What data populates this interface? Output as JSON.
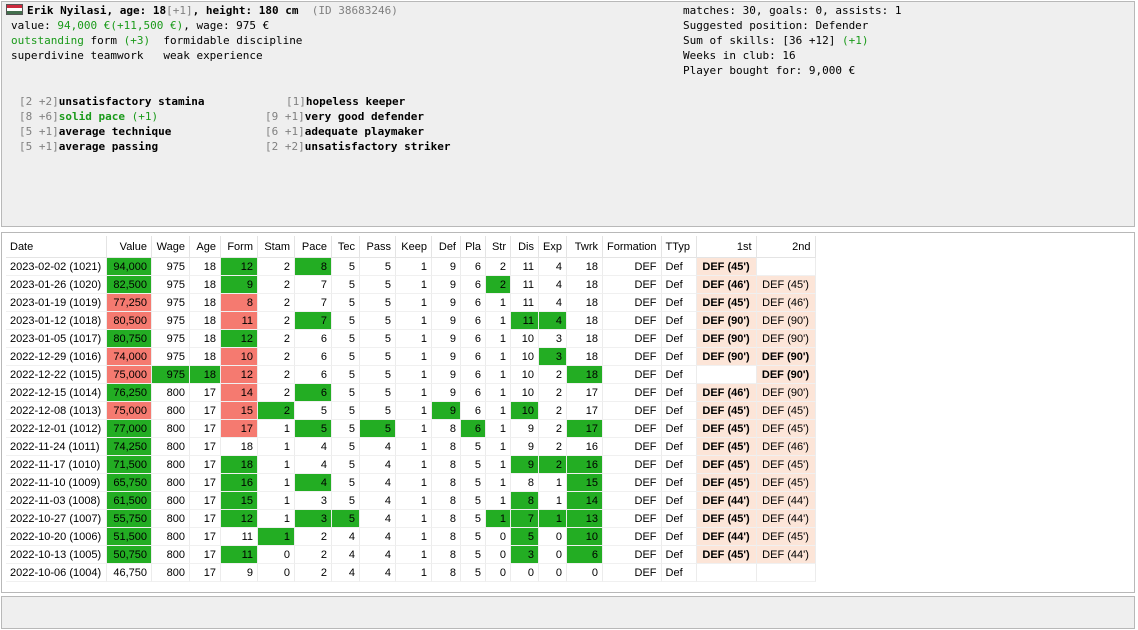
{
  "player": {
    "line1": {
      "name_age": "Erik Nyilasi, age: 18",
      "age_delta": "[+1]",
      "height": ", height: 180 cm",
      "id": "(ID 38683246)"
    },
    "line2": {
      "value_label": "value: ",
      "value": "94,000 €(+11,500 €)",
      "wage": ", wage: 975 €"
    },
    "line3": {
      "form": "outstanding",
      "form_word": " form ",
      "form_delta": "(+3)",
      "discipline": "formidable discipline"
    },
    "line4": {
      "teamwork": "superdivine teamwork",
      "experience": "weak experience"
    },
    "flag_colors": [
      "#cd2a3e",
      "#ffffff",
      "#436f4d"
    ]
  },
  "summary": {
    "matches": "matches: 30, goals: 0, assists: 1",
    "position": "Suggested position: Defender",
    "skills": "Sum of skills: [36 +12]",
    "skills_delta": "(+1)",
    "weeks": "Weeks in club: 16",
    "bought": "Player bought for: 9,000 €"
  },
  "skills_left": [
    {
      "bracket": "[2 +2]",
      "text": "unsatisfactory stamina",
      "delta": "",
      "green": false
    },
    {
      "bracket": "[8 +6]",
      "text": "solid pace",
      "delta": " (+1)",
      "green": true
    },
    {
      "bracket": "[5 +1]",
      "text": "average technique",
      "delta": "",
      "green": false
    },
    {
      "bracket": "[5 +1]",
      "text": "average passing",
      "delta": "",
      "green": false
    }
  ],
  "skills_right": [
    {
      "bracket": "[1]",
      "text": "hopeless keeper"
    },
    {
      "bracket": "[9 +1]",
      "text": "very good defender"
    },
    {
      "bracket": "[6 +1]",
      "text": "adequate playmaker"
    },
    {
      "bracket": "[2 +2]",
      "text": "unsatisfactory striker"
    }
  ],
  "table": {
    "headers": [
      "Date",
      "Value",
      "Wage",
      "Age",
      "Form",
      "Stam",
      "Pace",
      "Tec",
      "Pass",
      "Keep",
      "Def",
      "Pla",
      "Str",
      "Dis",
      "Exp",
      "Twrk",
      "Formation",
      "TTyp",
      "1st",
      "2nd"
    ],
    "rows": [
      {
        "cells": [
          "2023-02-02 (1021)",
          "94,000",
          "975",
          "18",
          "12",
          "2",
          "8",
          "5",
          "5",
          "1",
          "9",
          "6",
          "2",
          "11",
          "4",
          "18",
          "DEF",
          "Def",
          "DEF (45')",
          ""
        ],
        "hl": {
          "1": "g",
          "4": "g",
          "6": "g"
        },
        "p": [
          "p1",
          "e"
        ]
      },
      {
        "cells": [
          "2023-01-26 (1020)",
          "82,500",
          "975",
          "18",
          "9",
          "2",
          "7",
          "5",
          "5",
          "1",
          "9",
          "6",
          "2",
          "11",
          "4",
          "18",
          "DEF",
          "Def",
          "DEF (46')",
          "DEF (45')"
        ],
        "hl": {
          "1": "g",
          "4": "g",
          "12": "g"
        },
        "p": [
          "p1",
          "p2"
        ]
      },
      {
        "cells": [
          "2023-01-19 (1019)",
          "77,250",
          "975",
          "18",
          "8",
          "2",
          "7",
          "5",
          "5",
          "1",
          "9",
          "6",
          "1",
          "11",
          "4",
          "18",
          "DEF",
          "Def",
          "DEF (45')",
          "DEF (46')"
        ],
        "hl": {
          "1": "r",
          "4": "r"
        },
        "p": [
          "p1",
          "p2"
        ]
      },
      {
        "cells": [
          "2023-01-12 (1018)",
          "80,500",
          "975",
          "18",
          "11",
          "2",
          "7",
          "5",
          "5",
          "1",
          "9",
          "6",
          "1",
          "11",
          "4",
          "18",
          "DEF",
          "Def",
          "DEF (90')",
          "DEF (90')"
        ],
        "hl": {
          "1": "r",
          "4": "r",
          "6": "g",
          "13": "g",
          "14": "g"
        },
        "p": [
          "p1",
          "p2"
        ]
      },
      {
        "cells": [
          "2023-01-05 (1017)",
          "80,750",
          "975",
          "18",
          "12",
          "2",
          "6",
          "5",
          "5",
          "1",
          "9",
          "6",
          "1",
          "10",
          "3",
          "18",
          "DEF",
          "Def",
          "DEF (90')",
          "DEF (90')"
        ],
        "hl": {
          "1": "g",
          "4": "g"
        },
        "p": [
          "p1",
          "p2"
        ]
      },
      {
        "cells": [
          "2022-12-29 (1016)",
          "74,000",
          "975",
          "18",
          "10",
          "2",
          "6",
          "5",
          "5",
          "1",
          "9",
          "6",
          "1",
          "10",
          "3",
          "18",
          "DEF",
          "Def",
          "DEF (90')",
          "DEF (90')"
        ],
        "hl": {
          "1": "r",
          "4": "r",
          "14": "g"
        },
        "p": [
          "p1",
          "p2b"
        ]
      },
      {
        "cells": [
          "2022-12-22 (1015)",
          "75,000",
          "975",
          "18",
          "12",
          "2",
          "6",
          "5",
          "5",
          "1",
          "9",
          "6",
          "1",
          "10",
          "2",
          "18",
          "DEF",
          "Def",
          "",
          "DEF (90')"
        ],
        "hl": {
          "1": "r",
          "2": "g",
          "3": "g",
          "4": "r",
          "15": "g"
        },
        "p": [
          "e",
          "p2b"
        ]
      },
      {
        "cells": [
          "2022-12-15 (1014)",
          "76,250",
          "800",
          "17",
          "14",
          "2",
          "6",
          "5",
          "5",
          "1",
          "9",
          "6",
          "1",
          "10",
          "2",
          "17",
          "DEF",
          "Def",
          "DEF (46')",
          "DEF (90')"
        ],
        "hl": {
          "1": "g",
          "4": "r",
          "6": "g"
        },
        "p": [
          "p1",
          "p2"
        ]
      },
      {
        "cells": [
          "2022-12-08 (1013)",
          "75,000",
          "800",
          "17",
          "15",
          "2",
          "5",
          "5",
          "5",
          "1",
          "9",
          "6",
          "1",
          "10",
          "2",
          "17",
          "DEF",
          "Def",
          "DEF (45')",
          "DEF (45')"
        ],
        "hl": {
          "1": "r",
          "4": "r",
          "5": "g",
          "10": "g",
          "13": "g"
        },
        "p": [
          "p1",
          "p2"
        ]
      },
      {
        "cells": [
          "2022-12-01 (1012)",
          "77,000",
          "800",
          "17",
          "17",
          "1",
          "5",
          "5",
          "5",
          "1",
          "8",
          "6",
          "1",
          "9",
          "2",
          "17",
          "DEF",
          "Def",
          "DEF (45')",
          "DEF (45')"
        ],
        "hl": {
          "1": "g",
          "4": "r",
          "6": "g",
          "8": "g",
          "11": "g",
          "15": "g"
        },
        "p": [
          "p1",
          "p2"
        ]
      },
      {
        "cells": [
          "2022-11-24 (1011)",
          "74,250",
          "800",
          "17",
          "18",
          "1",
          "4",
          "5",
          "4",
          "1",
          "8",
          "5",
          "1",
          "9",
          "2",
          "16",
          "DEF",
          "Def",
          "DEF (45')",
          "DEF (46')"
        ],
        "hl": {
          "1": "g"
        },
        "p": [
          "p1",
          "p2"
        ]
      },
      {
        "cells": [
          "2022-11-17 (1010)",
          "71,500",
          "800",
          "17",
          "18",
          "1",
          "4",
          "5",
          "4",
          "1",
          "8",
          "5",
          "1",
          "9",
          "2",
          "16",
          "DEF",
          "Def",
          "DEF (45')",
          "DEF (45')"
        ],
        "hl": {
          "1": "g",
          "4": "g",
          "13": "g",
          "14": "g",
          "15": "g"
        },
        "p": [
          "p1",
          "p2"
        ]
      },
      {
        "cells": [
          "2022-11-10 (1009)",
          "65,750",
          "800",
          "17",
          "16",
          "1",
          "4",
          "5",
          "4",
          "1",
          "8",
          "5",
          "1",
          "8",
          "1",
          "15",
          "DEF",
          "Def",
          "DEF (45')",
          "DEF (45')"
        ],
        "hl": {
          "1": "g",
          "4": "g",
          "6": "g",
          "15": "g"
        },
        "p": [
          "p1",
          "p2"
        ]
      },
      {
        "cells": [
          "2022-11-03 (1008)",
          "61,500",
          "800",
          "17",
          "15",
          "1",
          "3",
          "5",
          "4",
          "1",
          "8",
          "5",
          "1",
          "8",
          "1",
          "14",
          "DEF",
          "Def",
          "DEF (44')",
          "DEF (44')"
        ],
        "hl": {
          "1": "g",
          "4": "g",
          "13": "g",
          "15": "g"
        },
        "p": [
          "p1",
          "p2"
        ]
      },
      {
        "cells": [
          "2022-10-27 (1007)",
          "55,750",
          "800",
          "17",
          "12",
          "1",
          "3",
          "5",
          "4",
          "1",
          "8",
          "5",
          "1",
          "7",
          "1",
          "13",
          "DEF",
          "Def",
          "DEF (45')",
          "DEF (44')"
        ],
        "hl": {
          "1": "g",
          "4": "g",
          "6": "g",
          "7": "g",
          "12": "g",
          "13": "g",
          "14": "g",
          "15": "g"
        },
        "p": [
          "p1",
          "p2"
        ]
      },
      {
        "cells": [
          "2022-10-20 (1006)",
          "51,500",
          "800",
          "17",
          "11",
          "1",
          "2",
          "4",
          "4",
          "1",
          "8",
          "5",
          "0",
          "5",
          "0",
          "10",
          "DEF",
          "Def",
          "DEF (44')",
          "DEF (45')"
        ],
        "hl": {
          "1": "g",
          "5": "g",
          "13": "g",
          "15": "g"
        },
        "p": [
          "p1",
          "p2"
        ]
      },
      {
        "cells": [
          "2022-10-13 (1005)",
          "50,750",
          "800",
          "17",
          "11",
          "0",
          "2",
          "4",
          "4",
          "1",
          "8",
          "5",
          "0",
          "3",
          "0",
          "6",
          "DEF",
          "Def",
          "DEF (45')",
          "DEF (44')"
        ],
        "hl": {
          "1": "g",
          "4": "g",
          "13": "g",
          "15": "g"
        },
        "p": [
          "p1",
          "p2"
        ]
      },
      {
        "cells": [
          "2022-10-06 (1004)",
          "46,750",
          "800",
          "17",
          "9",
          "0",
          "2",
          "4",
          "4",
          "1",
          "8",
          "5",
          "0",
          "0",
          "0",
          "0",
          "DEF",
          "Def",
          "",
          ""
        ],
        "hl": {},
        "p": [
          "e",
          "e"
        ]
      }
    ]
  },
  "colors": {
    "green_cell": "#23ad23",
    "red_cell": "#f57a70",
    "position_cell": "#fce5d8",
    "green_text": "#1a9a1a"
  }
}
